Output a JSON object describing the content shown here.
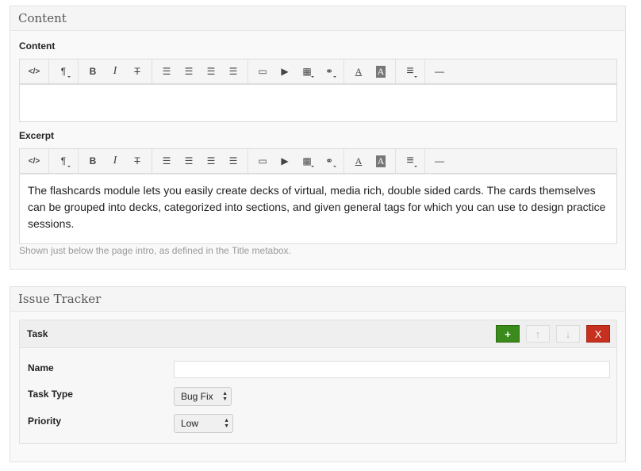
{
  "content_box": {
    "title": "Content",
    "content_label": "Content",
    "excerpt_label": "Excerpt",
    "excerpt_text": "The flashcards module lets you easily create decks of virtual, media rich, double sided cards. The cards themselves can be grouped into decks, categorized into sections, and given general tags for which you can use to design practice sessions.",
    "hint": "Shown just below the page intro, as defined in the Title metabox.",
    "toolbar": {
      "code": "</>",
      "paragraph": "¶",
      "bold": "B",
      "italic": "I",
      "strike": "T",
      "bullets": "☰",
      "numbered": "☰",
      "outdent": "☰",
      "indent": "☰",
      "image": "▭",
      "video": "▶",
      "table": "▦",
      "link": "⚭",
      "font_color": "A",
      "highlight": "A",
      "align": "≡",
      "hr": "—"
    }
  },
  "issue_box": {
    "title": "Issue Tracker",
    "task_title": "Task",
    "add": "+",
    "up": "↑",
    "down": "↓",
    "delete": "X",
    "name_label": "Name",
    "name_value": "",
    "type_label": "Task Type",
    "type_value": "Bug Fix",
    "priority_label": "Priority",
    "priority_value": "Low"
  },
  "colors": {
    "add_button": "#3a8a1c",
    "delete_button": "#c6301f"
  }
}
